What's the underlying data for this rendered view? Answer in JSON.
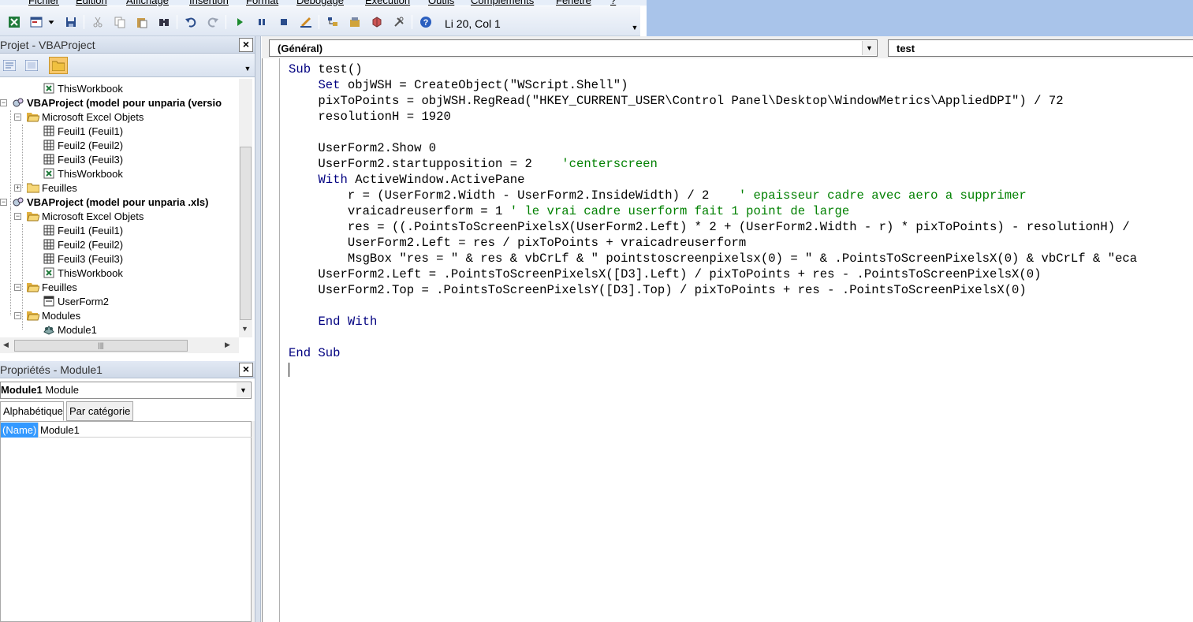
{
  "menubar": {
    "items": [
      "Fichier",
      "Edition",
      "Affichage",
      "Insertion",
      "Format",
      "Débogage",
      "Exécution",
      "Outils",
      "Compléments",
      "Fenêtre",
      "?"
    ]
  },
  "toolbar": {
    "position_label": "Li 20, Col 1",
    "icons": [
      "excel-icon",
      "insert-userform-icon",
      "save-icon",
      "cut-icon",
      "copy-icon",
      "paste-icon",
      "find-icon",
      "undo-icon",
      "redo-icon",
      "run-icon",
      "break-icon",
      "reset-icon",
      "design-mode-icon",
      "project-explorer-icon",
      "properties-icon",
      "object-browser-icon",
      "toolbox-icon",
      "help-icon"
    ]
  },
  "project_pane": {
    "title": "Projet - VBAProject",
    "tree": [
      {
        "label": "ThisWorkbook",
        "icon": "workbook-icon"
      },
      {
        "label": "VBAProject (model pour unparia  (versio",
        "icon": "vba-project-icon",
        "bold": true
      },
      {
        "label": "Microsoft Excel Objets",
        "icon": "folder-open-icon"
      },
      {
        "label": "Feuil1 (Feuil1)",
        "icon": "sheet-icon"
      },
      {
        "label": "Feuil2 (Feuil2)",
        "icon": "sheet-icon"
      },
      {
        "label": "Feuil3 (Feuil3)",
        "icon": "sheet-icon"
      },
      {
        "label": "ThisWorkbook",
        "icon": "workbook-icon"
      },
      {
        "label": "Feuilles",
        "icon": "folder-closed-icon"
      },
      {
        "label": "VBAProject (model pour unparia .xls)",
        "icon": "vba-project-icon",
        "bold": true
      },
      {
        "label": "Microsoft Excel Objets",
        "icon": "folder-open-icon"
      },
      {
        "label": "Feuil1 (Feuil1)",
        "icon": "sheet-icon"
      },
      {
        "label": "Feuil2 (Feuil2)",
        "icon": "sheet-icon"
      },
      {
        "label": "Feuil3 (Feuil3)",
        "icon": "sheet-icon"
      },
      {
        "label": "ThisWorkbook",
        "icon": "workbook-icon"
      },
      {
        "label": "Feuilles",
        "icon": "folder-open-icon"
      },
      {
        "label": "UserForm2",
        "icon": "userform-icon"
      },
      {
        "label": "Modules",
        "icon": "folder-open-icon"
      },
      {
        "label": "Module1",
        "icon": "module-icon"
      }
    ]
  },
  "properties_pane": {
    "title": "Propriétés - Module1",
    "object_name": "Module1",
    "object_type": "Module",
    "tabs": [
      "Alphabétique",
      "Par catégorie"
    ],
    "rows": [
      {
        "name": "(Name)",
        "value": "Module1"
      }
    ]
  },
  "code_window": {
    "object_combo": "(Général)",
    "proc_combo": "test",
    "lines": [
      [
        {
          "t": "Sub",
          "c": "kw"
        },
        {
          "t": " test()",
          "c": ""
        }
      ],
      [
        {
          "t": "    ",
          "c": ""
        },
        {
          "t": "Set",
          "c": "kw"
        },
        {
          "t": " objWSH = CreateObject(\"WScript.Shell\")",
          "c": ""
        }
      ],
      [
        {
          "t": "    pixToPoints = objWSH.RegRead(\"HKEY_CURRENT_USER\\Control Panel\\Desktop\\WindowMetrics\\AppliedDPI\") / 72",
          "c": ""
        }
      ],
      [
        {
          "t": "    resolutionH = 1920",
          "c": ""
        }
      ],
      [
        {
          "t": "",
          "c": ""
        }
      ],
      [
        {
          "t": "    UserForm2.Show 0",
          "c": ""
        }
      ],
      [
        {
          "t": "    UserForm2.startupposition = 2    ",
          "c": ""
        },
        {
          "t": "'centerscreen",
          "c": "cm"
        }
      ],
      [
        {
          "t": "    ",
          "c": ""
        },
        {
          "t": "With",
          "c": "kw"
        },
        {
          "t": " ActiveWindow.ActivePane",
          "c": ""
        }
      ],
      [
        {
          "t": "        r = (UserForm2.Width - UserForm2.InsideWidth) / 2    ",
          "c": ""
        },
        {
          "t": "' epaisseur cadre avec aero a supprimer",
          "c": "cm"
        }
      ],
      [
        {
          "t": "        vraicadreuserform = 1 ",
          "c": ""
        },
        {
          "t": "' le vrai cadre userform fait 1 point de large",
          "c": "cm"
        }
      ],
      [
        {
          "t": "        res = ((.PointsToScreenPixelsX(UserForm2.Left) * 2 + (UserForm2.Width - r) * pixToPoints) - resolutionH) / ",
          "c": ""
        }
      ],
      [
        {
          "t": "        UserForm2.Left = res / pixToPoints + vraicadreuserform",
          "c": ""
        }
      ],
      [
        {
          "t": "        MsgBox \"res = \" & res & vbCrLf & \" pointstoscreenpixelsx(0) = \" & .PointsToScreenPixelsX(0) & vbCrLf & \"eca",
          "c": ""
        }
      ],
      [
        {
          "t": "    UserForm2.Left = .PointsToScreenPixelsX([D3].Left) / pixToPoints + res - .PointsToScreenPixelsX(0)",
          "c": ""
        }
      ],
      [
        {
          "t": "    UserForm2.Top = .PointsToScreenPixelsY([D3].Top) / pixToPoints + res - .PointsToScreenPixelsX(0)",
          "c": ""
        }
      ],
      [
        {
          "t": "",
          "c": ""
        }
      ],
      [
        {
          "t": "    ",
          "c": ""
        },
        {
          "t": "End With",
          "c": "kw"
        }
      ],
      [
        {
          "t": "",
          "c": ""
        }
      ],
      [
        {
          "t": "End Sub",
          "c": "kw"
        }
      ]
    ]
  },
  "colors": {
    "keyword": "#000080",
    "comment": "#008000",
    "selection": "#3399ff"
  }
}
